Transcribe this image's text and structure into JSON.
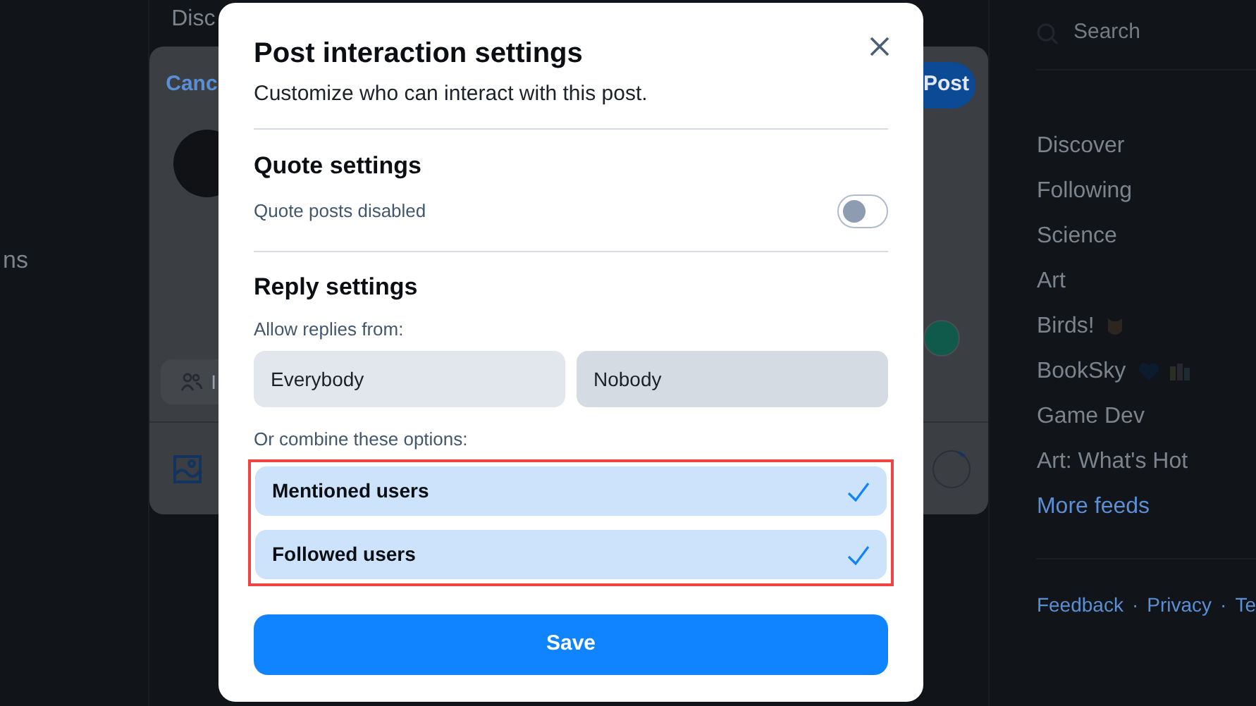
{
  "background": {
    "left_column": {
      "text": "ns"
    },
    "feed_tab": {
      "label": "Disc"
    },
    "composer": {
      "cancel": "Canc",
      "post": "Post",
      "interaction_label": "I"
    },
    "sidebar": {
      "search": {
        "placeholder": "Search"
      },
      "feeds": [
        {
          "label": "Discover"
        },
        {
          "label": "Following"
        },
        {
          "label": "Science"
        },
        {
          "label": "Art"
        },
        {
          "label": "Birds!",
          "kind": "owl"
        },
        {
          "label": "BookSky",
          "kind": "hearts"
        },
        {
          "label": "Game Dev"
        },
        {
          "label": "Art: What's Hot"
        }
      ],
      "more_feeds": "More feeds",
      "footer_links": [
        "Feedback",
        "Privacy",
        "Te"
      ],
      "footer_separator": "·"
    }
  },
  "dialog": {
    "title": "Post interaction settings",
    "subtitle": "Customize who can interact with this post.",
    "quote": {
      "heading": "Quote settings",
      "label": "Quote posts disabled",
      "on": false
    },
    "reply": {
      "heading": "Reply settings",
      "allow_label": "Allow replies from:",
      "choices": [
        {
          "label": "Everybody",
          "selected": false,
          "hovered": false
        },
        {
          "label": "Nobody",
          "selected": false,
          "hovered": true
        }
      ],
      "combine_label": "Or combine these options:",
      "highlighted": true,
      "options": [
        {
          "label": "Mentioned users",
          "checked": true
        },
        {
          "label": "Followed users",
          "checked": true
        }
      ]
    },
    "save": "Save"
  }
}
